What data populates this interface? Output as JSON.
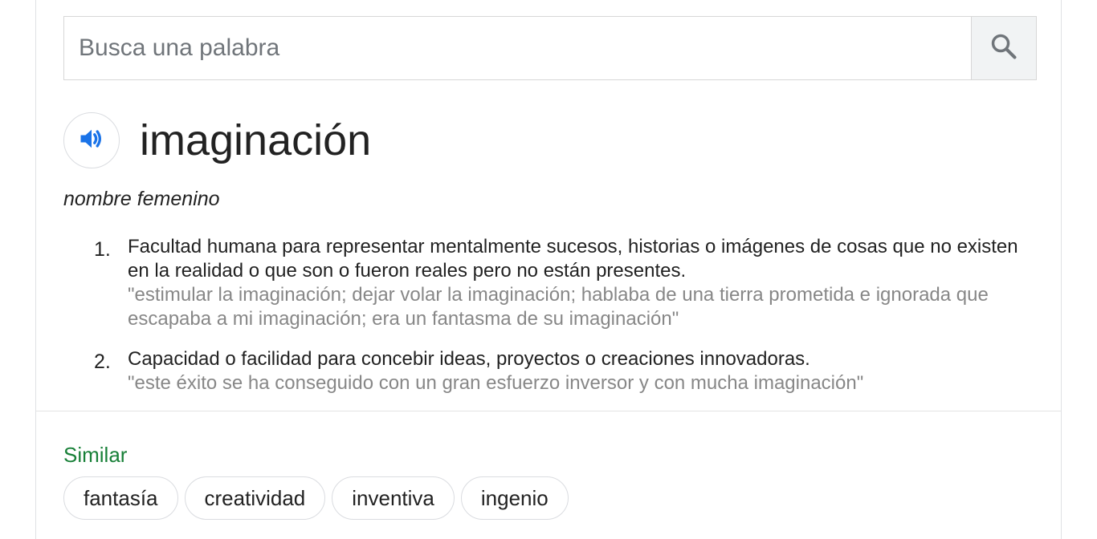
{
  "search": {
    "placeholder": "Busca una palabra"
  },
  "entry": {
    "headword": "imaginación",
    "part_of_speech": "nombre femenino",
    "definitions": [
      {
        "number": "1.",
        "text": "Facultad humana para representar mentalmente sucesos, historias o imágenes de cosas que no existen en la realidad o que son o fueron reales pero no están presentes.",
        "example": "\"estimular la imaginación; dejar volar la imaginación; hablaba de una tierra prometida e ignorada que escapaba a mi imaginación; era un fantasma de su imaginación\""
      },
      {
        "number": "2.",
        "text": "Capacidad o facilidad para concebir ideas, proyectos o creaciones innovadoras.",
        "example": "\"este éxito se ha conseguido con un gran esfuerzo inversor y con mucha imaginación\""
      }
    ]
  },
  "similar": {
    "label": "Similar",
    "words": [
      "fantasía",
      "creatividad",
      "inventiva",
      "ingenio"
    ]
  },
  "icons": {
    "search": "search-icon",
    "speaker": "speaker-icon"
  },
  "colors": {
    "speaker_blue": "#1a73e8",
    "similar_green": "#188038",
    "example_gray": "#878787"
  }
}
